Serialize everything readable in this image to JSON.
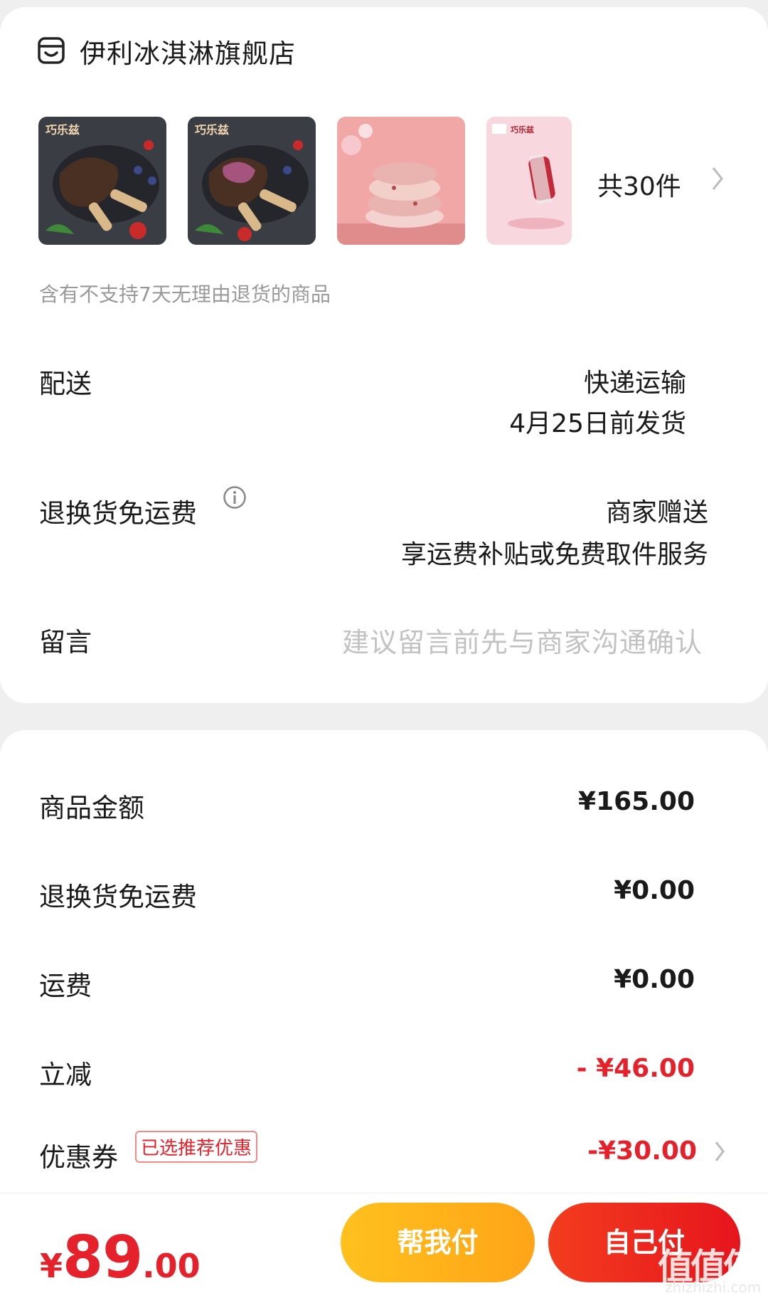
{
  "store": {
    "name": "伊利冰淇淋旗舰店",
    "icon": "store-icon"
  },
  "products": {
    "items": [
      {
        "name": "product-1",
        "badge": "巧乐兹"
      },
      {
        "name": "product-2",
        "badge": "巧乐兹"
      },
      {
        "name": "product-3",
        "badge": ""
      },
      {
        "name": "product-4",
        "badge": "巧乐兹"
      }
    ],
    "count_label": "共30件"
  },
  "notice": "含有不支持7天无理由退货的商品",
  "delivery": {
    "label": "配送",
    "method": "快递运输",
    "date": "4月25日前发货"
  },
  "return_shipping": {
    "label": "退换货免运费",
    "value": "商家赠送",
    "desc": "享运费补贴或免费取件服务"
  },
  "message": {
    "label": "留言",
    "placeholder": "建议留言前先与商家沟通确认"
  },
  "summary": {
    "goods_label": "商品金额",
    "goods_value": "¥165.00",
    "return_label": "退换货免运费",
    "return_value": "¥0.00",
    "shipping_label": "运费",
    "shipping_value": "¥0.00",
    "discount_label": "立减",
    "discount_value": "- ¥46.00",
    "coupon_label": "优惠券",
    "coupon_badge": "已选推荐优惠",
    "coupon_value": "-¥30.00"
  },
  "bottom": {
    "currency": "¥",
    "total_int": "89",
    "total_dec": ".00",
    "help_pay": "帮我付",
    "self_pay": "自己付",
    "watermark": "值值值",
    "watermark_sub": "zhizhizhi.com"
  },
  "colors": {
    "accent_red": "#e5222b",
    "help_yellow": "#ffb31a",
    "background": "#efefef"
  }
}
